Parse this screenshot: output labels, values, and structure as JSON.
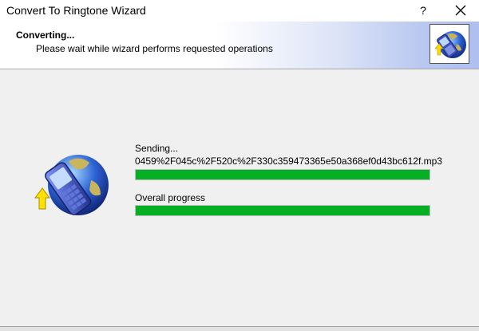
{
  "window": {
    "title": "Convert To Ringtone Wizard",
    "help_label": "?",
    "close_label": "close"
  },
  "header": {
    "title": "Converting...",
    "subtitle": "Please wait while wizard performs requested operations",
    "icon": "phone-globe-icon"
  },
  "main": {
    "icon": "phone-globe-icon",
    "status_text": "Sending...",
    "file_name": "0459%2F045c%2F520c%2F330c359473365e50a368ef0d43bc612f.mp3",
    "file_progress_percent": 100,
    "overall_label": "Overall progress",
    "overall_progress_percent": 100
  },
  "colors": {
    "progress_fill": "#06b025",
    "header_gradient_end": "#aebff0"
  }
}
